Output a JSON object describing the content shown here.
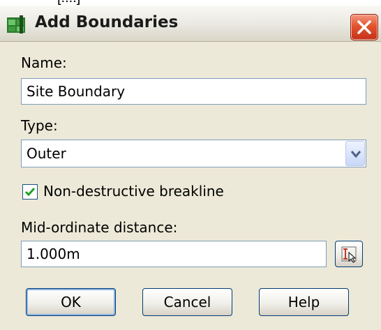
{
  "window": {
    "partial_text_above": "[....]",
    "title": "Add Boundaries",
    "close_icon": "close-x-icon",
    "app_icon": "civil-3d-surface-icon"
  },
  "form": {
    "name_label": "Name:",
    "name_value": "Site Boundary",
    "type_label": "Type:",
    "type_value": "Outer",
    "checkbox_label": "Non-destructive breakline",
    "checkbox_checked": true,
    "midordinate_label": "Mid-ordinate distance:",
    "midordinate_value": "1.000m"
  },
  "buttons": {
    "ok": "OK",
    "cancel": "Cancel",
    "help": "Help"
  },
  "colors": {
    "dialog_bg": "#ece9d8",
    "close_button": "#e1542e",
    "checkmark": "#21a121",
    "input_border": "#7f9db9"
  }
}
